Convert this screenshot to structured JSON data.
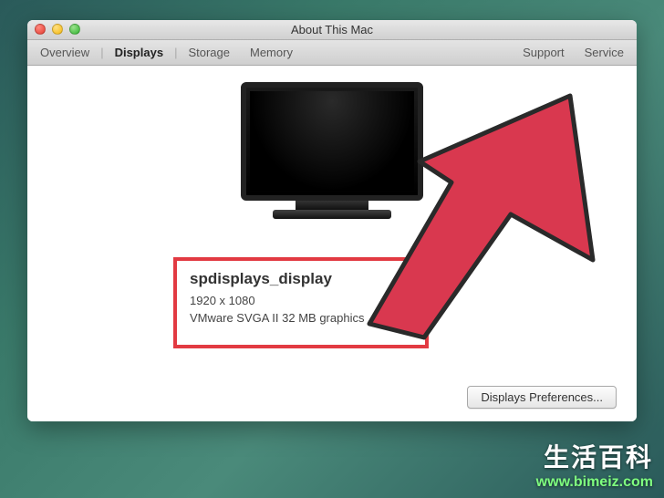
{
  "window": {
    "title": "About This Mac"
  },
  "tabs": {
    "overview": "Overview",
    "displays": "Displays",
    "storage": "Storage",
    "memory": "Memory"
  },
  "toolbar_right": {
    "support": "Support",
    "service": "Service"
  },
  "display_info": {
    "title": "spdisplays_display",
    "resolution": "1920 x 1080",
    "gpu": "VMware SVGA II 32 MB graphics"
  },
  "buttons": {
    "displays_prefs": "Displays Preferences..."
  },
  "watermark": {
    "cn": "生活百科",
    "url": "www.bimeiz.com"
  }
}
